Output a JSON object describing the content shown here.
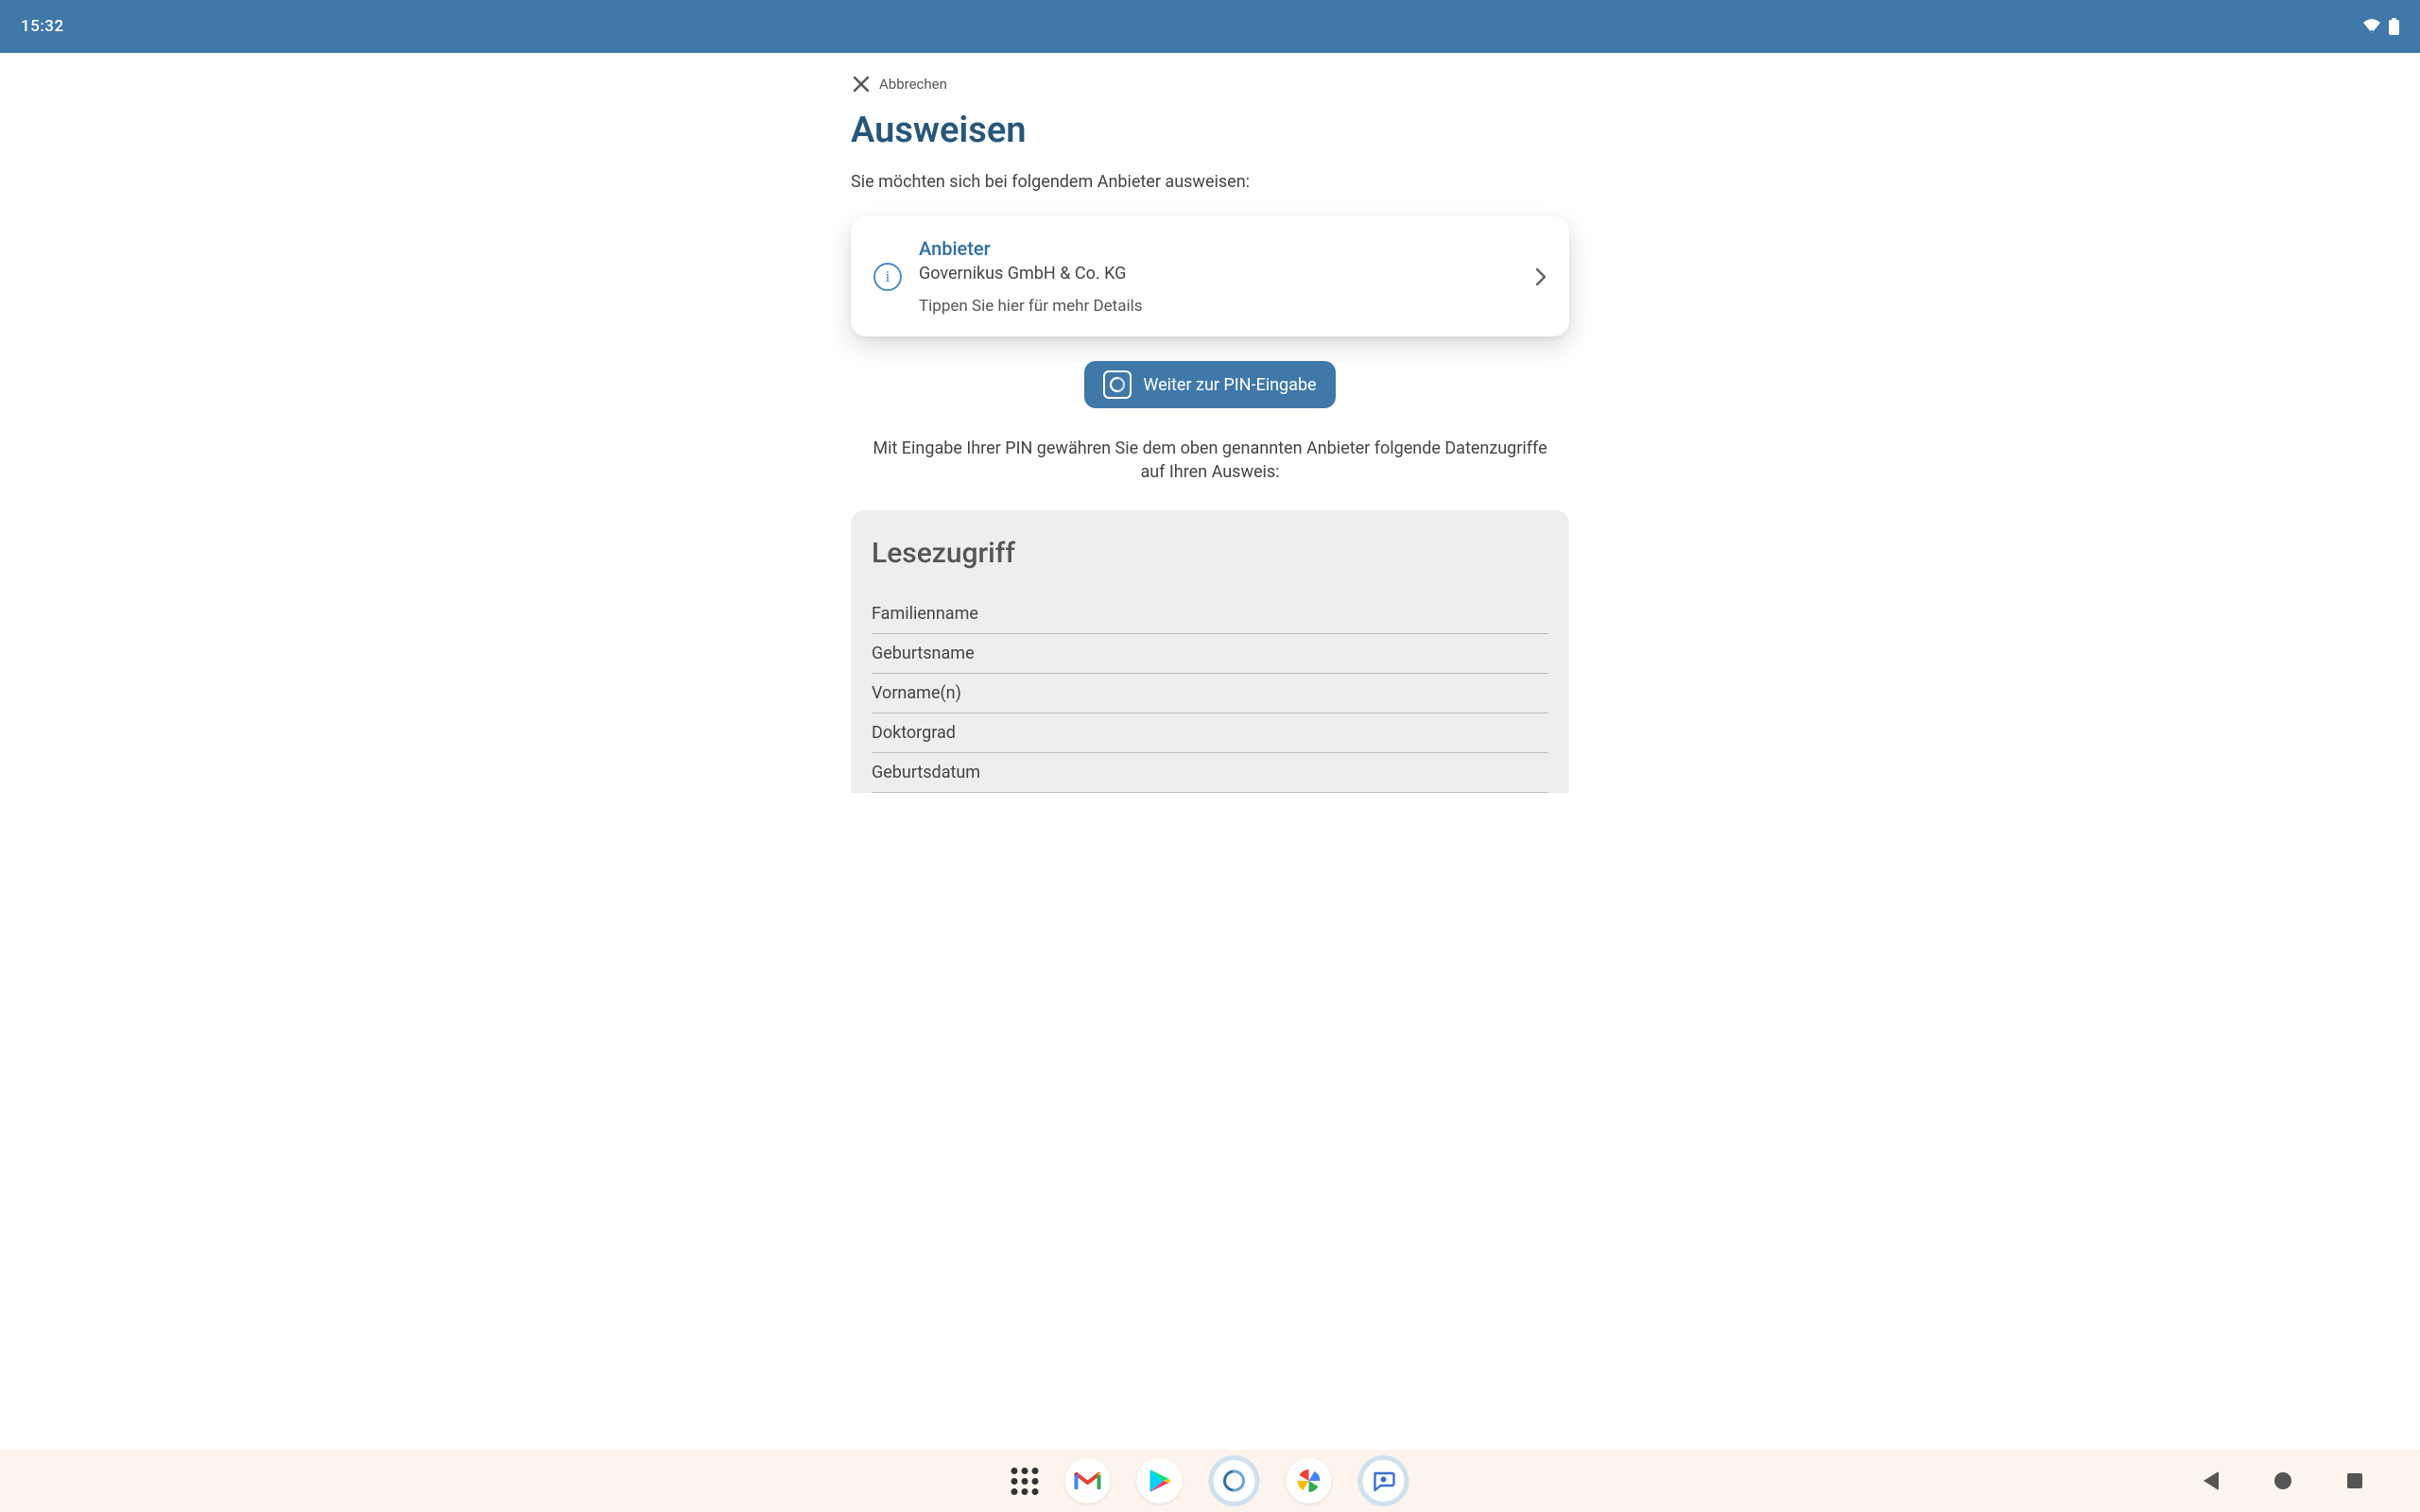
{
  "status": {
    "time": "15:32"
  },
  "cancel": {
    "label": "Abbrechen"
  },
  "title": "Ausweisen",
  "subtitle": "Sie möchten sich bei folgendem Anbieter ausweisen:",
  "provider": {
    "label": "Anbieter",
    "name": "Governikus GmbH & Co. KG",
    "hint": "Tippen Sie hier für mehr Details"
  },
  "cta": {
    "label": "Weiter zur PIN-Eingabe"
  },
  "info_text": "Mit Eingabe Ihrer PIN gewähren Sie dem oben genannten Anbieter folgende Datenzugriffe auf Ihren Ausweis:",
  "read_access": {
    "heading": "Lesezugriff",
    "items": [
      "Familienname",
      "Geburtsname",
      "Vorname(n)",
      "Doktorgrad",
      "Geburtsdatum"
    ]
  },
  "colors": {
    "primary": "#4078a9",
    "title": "#27567c"
  }
}
